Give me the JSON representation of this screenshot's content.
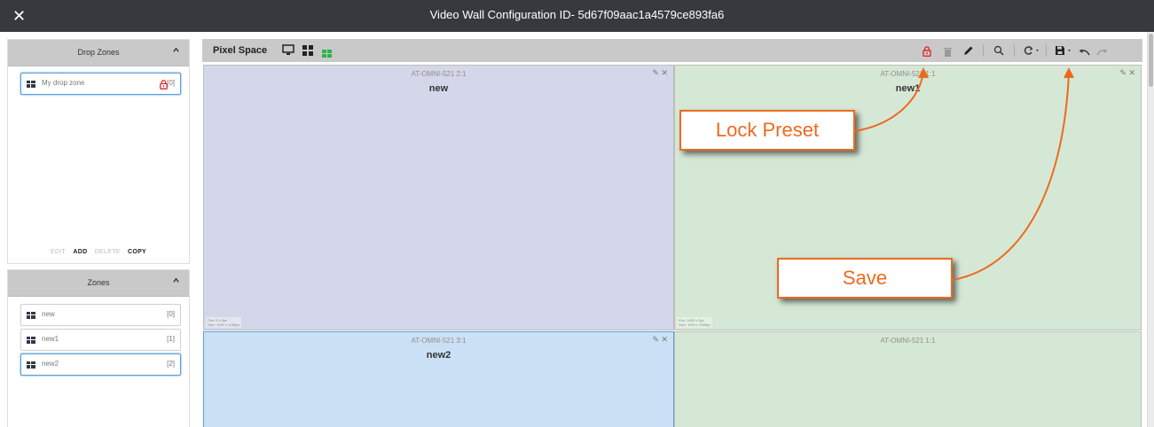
{
  "window": {
    "title": "Video Wall Configuration ID- 5d67f09aac1a4579ce893fa6",
    "close_glyph": "✕"
  },
  "drop_zones_panel": {
    "title": "Drop Zones",
    "items": [
      {
        "name": "My drop zone",
        "index": "[0]",
        "locked": true,
        "icon": "video-wall-icon"
      }
    ],
    "actions": {
      "edit": "EDIT",
      "add": "ADD",
      "delete": "DELETE",
      "copy": "COPY"
    }
  },
  "zones_panel": {
    "title": "Zones",
    "items": [
      {
        "name": "new",
        "index": "[0]",
        "selected": false
      },
      {
        "name": "new1",
        "index": "[1]",
        "selected": false
      },
      {
        "name": "new2",
        "index": "[2]",
        "selected": true
      }
    ]
  },
  "toolbar": {
    "title": "Pixel Space",
    "icons": [
      "monitor-icon",
      "grid-icon",
      "layout-icon",
      "lock-icon",
      "delete-icon",
      "edit-pencil-icon",
      "zoom-icon",
      "refresh-icon",
      "save-icon",
      "undo-icon",
      "redo-icon"
    ]
  },
  "canvas": {
    "tiles": [
      {
        "device": "AT-OMNI-521 2:1",
        "name": "new",
        "pos": "Pos: 0 x 0px",
        "size": "Size: 1920 x 1080px",
        "bg": "#d4d7ea",
        "controls": "✎ ✕"
      },
      {
        "device": "AT-OMNI-521 1:1",
        "name": "new1",
        "pos": "Pos: 1920 x 0px",
        "size": "Size: 1920 x 1080px",
        "bg": "#d5e8d5",
        "controls": "✎ ✕"
      },
      {
        "device": "AT-OMNI-521 3:1",
        "name": "new2",
        "pos": "",
        "size": "",
        "bg": "#cce0f5",
        "controls": "✎ ✕"
      },
      {
        "device": "AT-OMNI-521 1:1",
        "name": "",
        "pos": "",
        "size": "",
        "bg": "#d5e8d5",
        "controls": ""
      }
    ]
  },
  "annotations": {
    "lock_preset": "Lock Preset",
    "save": "Save",
    "color": "#ec6a1f"
  },
  "colors": {
    "titlebar": "#363a3f",
    "panel_header": "#c9c9c9",
    "lock_red": "#e0282b",
    "active_green": "#2bb34a",
    "selection_blue": "#5a9fd8"
  }
}
